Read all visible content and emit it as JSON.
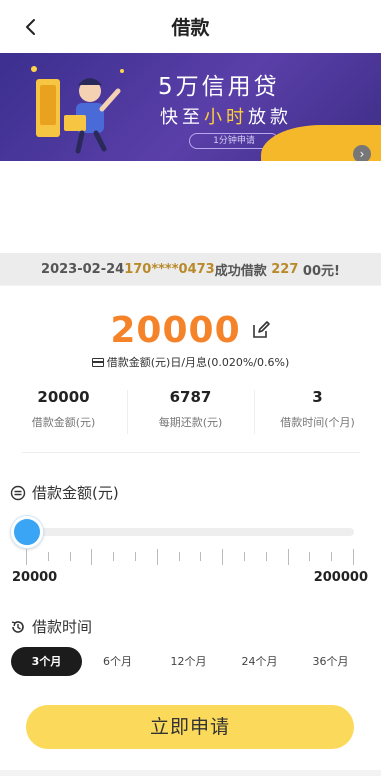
{
  "header": {
    "title": "借款",
    "back_icon": "chevron-left-icon"
  },
  "banner": {
    "line1": "5万信用贷",
    "line2_prefix": "快至",
    "line2_highlight": "小时",
    "line2_suffix": "放款",
    "pill": "1分钟申请",
    "arrow_icon": "chevron-right-icon",
    "colors": {
      "background": "#3b2f8f",
      "accent": "#ffcf38",
      "wave": "#f6b82b"
    }
  },
  "notice": {
    "date": "2023-02-24",
    "phone": "170****0473",
    "middle": "成功借款",
    "amount": "227",
    "suffix": "00元!"
  },
  "loan": {
    "amount": "20000",
    "edit_icon": "edit-icon",
    "rate_text": "借款金额(元)日/月息(0.020%/0.6%)"
  },
  "stats": [
    {
      "value": "20000",
      "label": "借款金额(元)"
    },
    {
      "value": "6787",
      "label": "每期还款(元)"
    },
    {
      "value": "3",
      "label": "借款时间(个月)"
    }
  ],
  "amount_section": {
    "label": "借款金额(元)",
    "min": "20000",
    "max": "200000",
    "slider_fraction": 0.0
  },
  "term_section": {
    "label": "借款时间",
    "options": [
      "3个月",
      "6个月",
      "12个月",
      "24个月",
      "36个月"
    ],
    "selected": "3个月"
  },
  "apply_button": "立即申请",
  "colors": {
    "amount": "#f5832a",
    "slider": "#3aa4f5",
    "button": "#fbd95a",
    "active_term": "#1c1c1c"
  }
}
